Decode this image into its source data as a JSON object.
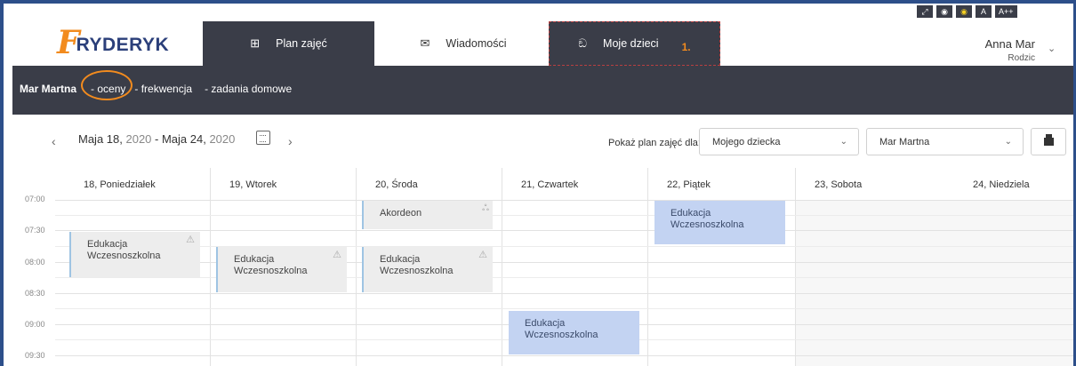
{
  "header": {
    "logo_letter": "F",
    "logo_text": "RYDERYK",
    "nav": [
      {
        "label": "Plan zajęć",
        "icon": "calendar-grid-icon"
      },
      {
        "label": "Wiadomości",
        "icon": "envelope-icon"
      },
      {
        "label": "Moje dzieci",
        "icon": "children-icon"
      }
    ],
    "step_marker": "1.",
    "accessibility": [
      "⤢",
      "◉",
      "◉",
      "A",
      "A++"
    ],
    "user_name": "Anna Mar",
    "user_role": "Rodzic"
  },
  "subbar": {
    "child_name": "Mar Martna",
    "links": [
      "- oceny",
      "- frekwencja",
      "- zadania domowe"
    ]
  },
  "toolbar": {
    "prev": "‹",
    "next": "›",
    "date_start": "Maja 18, ",
    "year_start": "2020",
    "date_sep": " - Maja 24, ",
    "year_end": "2020",
    "show_for_label": "Pokaż plan zajęć dla:",
    "select_who": "Mojego dziecka",
    "select_child": "Mar Martna"
  },
  "calendar": {
    "days": [
      "18, Poniedziałek",
      "19, Wtorek",
      "20, Środa",
      "21, Czwartek",
      "22, Piątek",
      "23, Sobota",
      "24, Niedziela"
    ],
    "times": [
      "07:00",
      "07:30",
      "08:00",
      "08:30",
      "09:00",
      "09:30"
    ],
    "events": [
      {
        "day": "Poniedziałek",
        "title_1": "Edukacja",
        "title_2": "Wczesnoszkolna",
        "icon": "warning-icon"
      },
      {
        "day": "Wtorek",
        "title_1": "Edukacja",
        "title_2": "Wczesnoszkolna",
        "icon": "warning-icon"
      },
      {
        "day": "Środa",
        "title_1": "Akordeon",
        "title_2": "",
        "icon": "group-icon"
      },
      {
        "day": "Środa",
        "title_1": "Edukacja",
        "title_2": "Wczesnoszkolna",
        "icon": "warning-icon"
      },
      {
        "day": "Czwartek",
        "title_1": "Edukacja",
        "title_2": "Wczesnoszkolna",
        "icon": ""
      },
      {
        "day": "Piątek",
        "title_1": "Edukacja",
        "title_2": "Wczesnoszkolna",
        "icon": ""
      }
    ]
  },
  "colors": {
    "accent_orange": "#f28b1e",
    "nav_dark": "#3a3d48",
    "event_blue": "#c3d3f2",
    "event_grey": "#ededed",
    "frame_blue": "#2d4f8a"
  }
}
